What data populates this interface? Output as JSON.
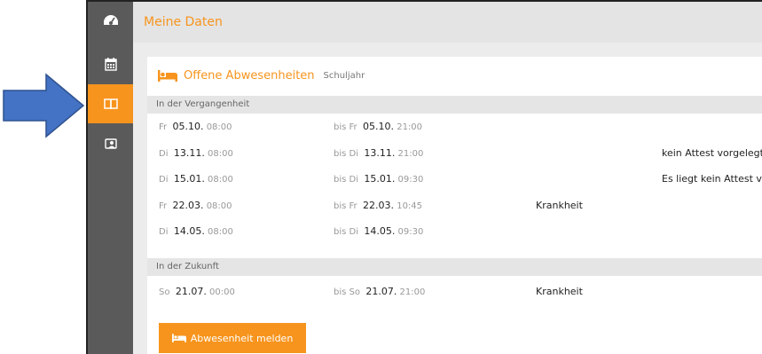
{
  "colors": {
    "accent": "#f7941d",
    "sidebar": "#5a5a5a",
    "arrow": "#4472c4"
  },
  "sidebar": {
    "items": [
      {
        "icon": "dashboard-icon",
        "active": false
      },
      {
        "icon": "calendar-icon",
        "active": false
      },
      {
        "icon": "book-icon",
        "active": true
      },
      {
        "icon": "user-badge-icon",
        "active": false
      }
    ]
  },
  "header": {
    "title": "Meine Daten"
  },
  "panel": {
    "icon": "bed-icon",
    "title": "Offene Abwesenheiten",
    "subtitle": "Schuljahr"
  },
  "sections": {
    "past": "In der Vergangenheit",
    "future": "In der Zukunft"
  },
  "absences_past": [
    {
      "from_day": "Fr",
      "from_date": "05.10.",
      "from_time": "08:00",
      "to_day": "bis Fr",
      "to_date": "05.10.",
      "to_time": "21:00",
      "reason": "",
      "note": ""
    },
    {
      "from_day": "Di",
      "from_date": "13.11.",
      "from_time": "08:00",
      "to_day": "bis Di",
      "to_date": "13.11.",
      "to_time": "21:00",
      "reason": "",
      "note": "kein Attest vorgelegt"
    },
    {
      "from_day": "Di",
      "from_date": "15.01.",
      "from_time": "08:00",
      "to_day": "bis Di",
      "to_date": "15.01.",
      "to_time": "09:30",
      "reason": "",
      "note": "Es liegt kein Attest vor"
    },
    {
      "from_day": "Fr",
      "from_date": "22.03.",
      "from_time": "08:00",
      "to_day": "bis Fr",
      "to_date": "22.03.",
      "to_time": "10:45",
      "reason": "Krankheit",
      "note": ""
    },
    {
      "from_day": "Di",
      "from_date": "14.05.",
      "from_time": "08:00",
      "to_day": "bis Di",
      "to_date": "14.05.",
      "to_time": "09:30",
      "reason": "",
      "note": ""
    }
  ],
  "absences_future": [
    {
      "from_day": "So",
      "from_date": "21.07.",
      "from_time": "00:00",
      "to_day": "bis So",
      "to_date": "21.07.",
      "to_time": "21:00",
      "reason": "Krankheit",
      "note": ""
    }
  ],
  "actions": {
    "report_label": "Abwesenheit melden"
  }
}
